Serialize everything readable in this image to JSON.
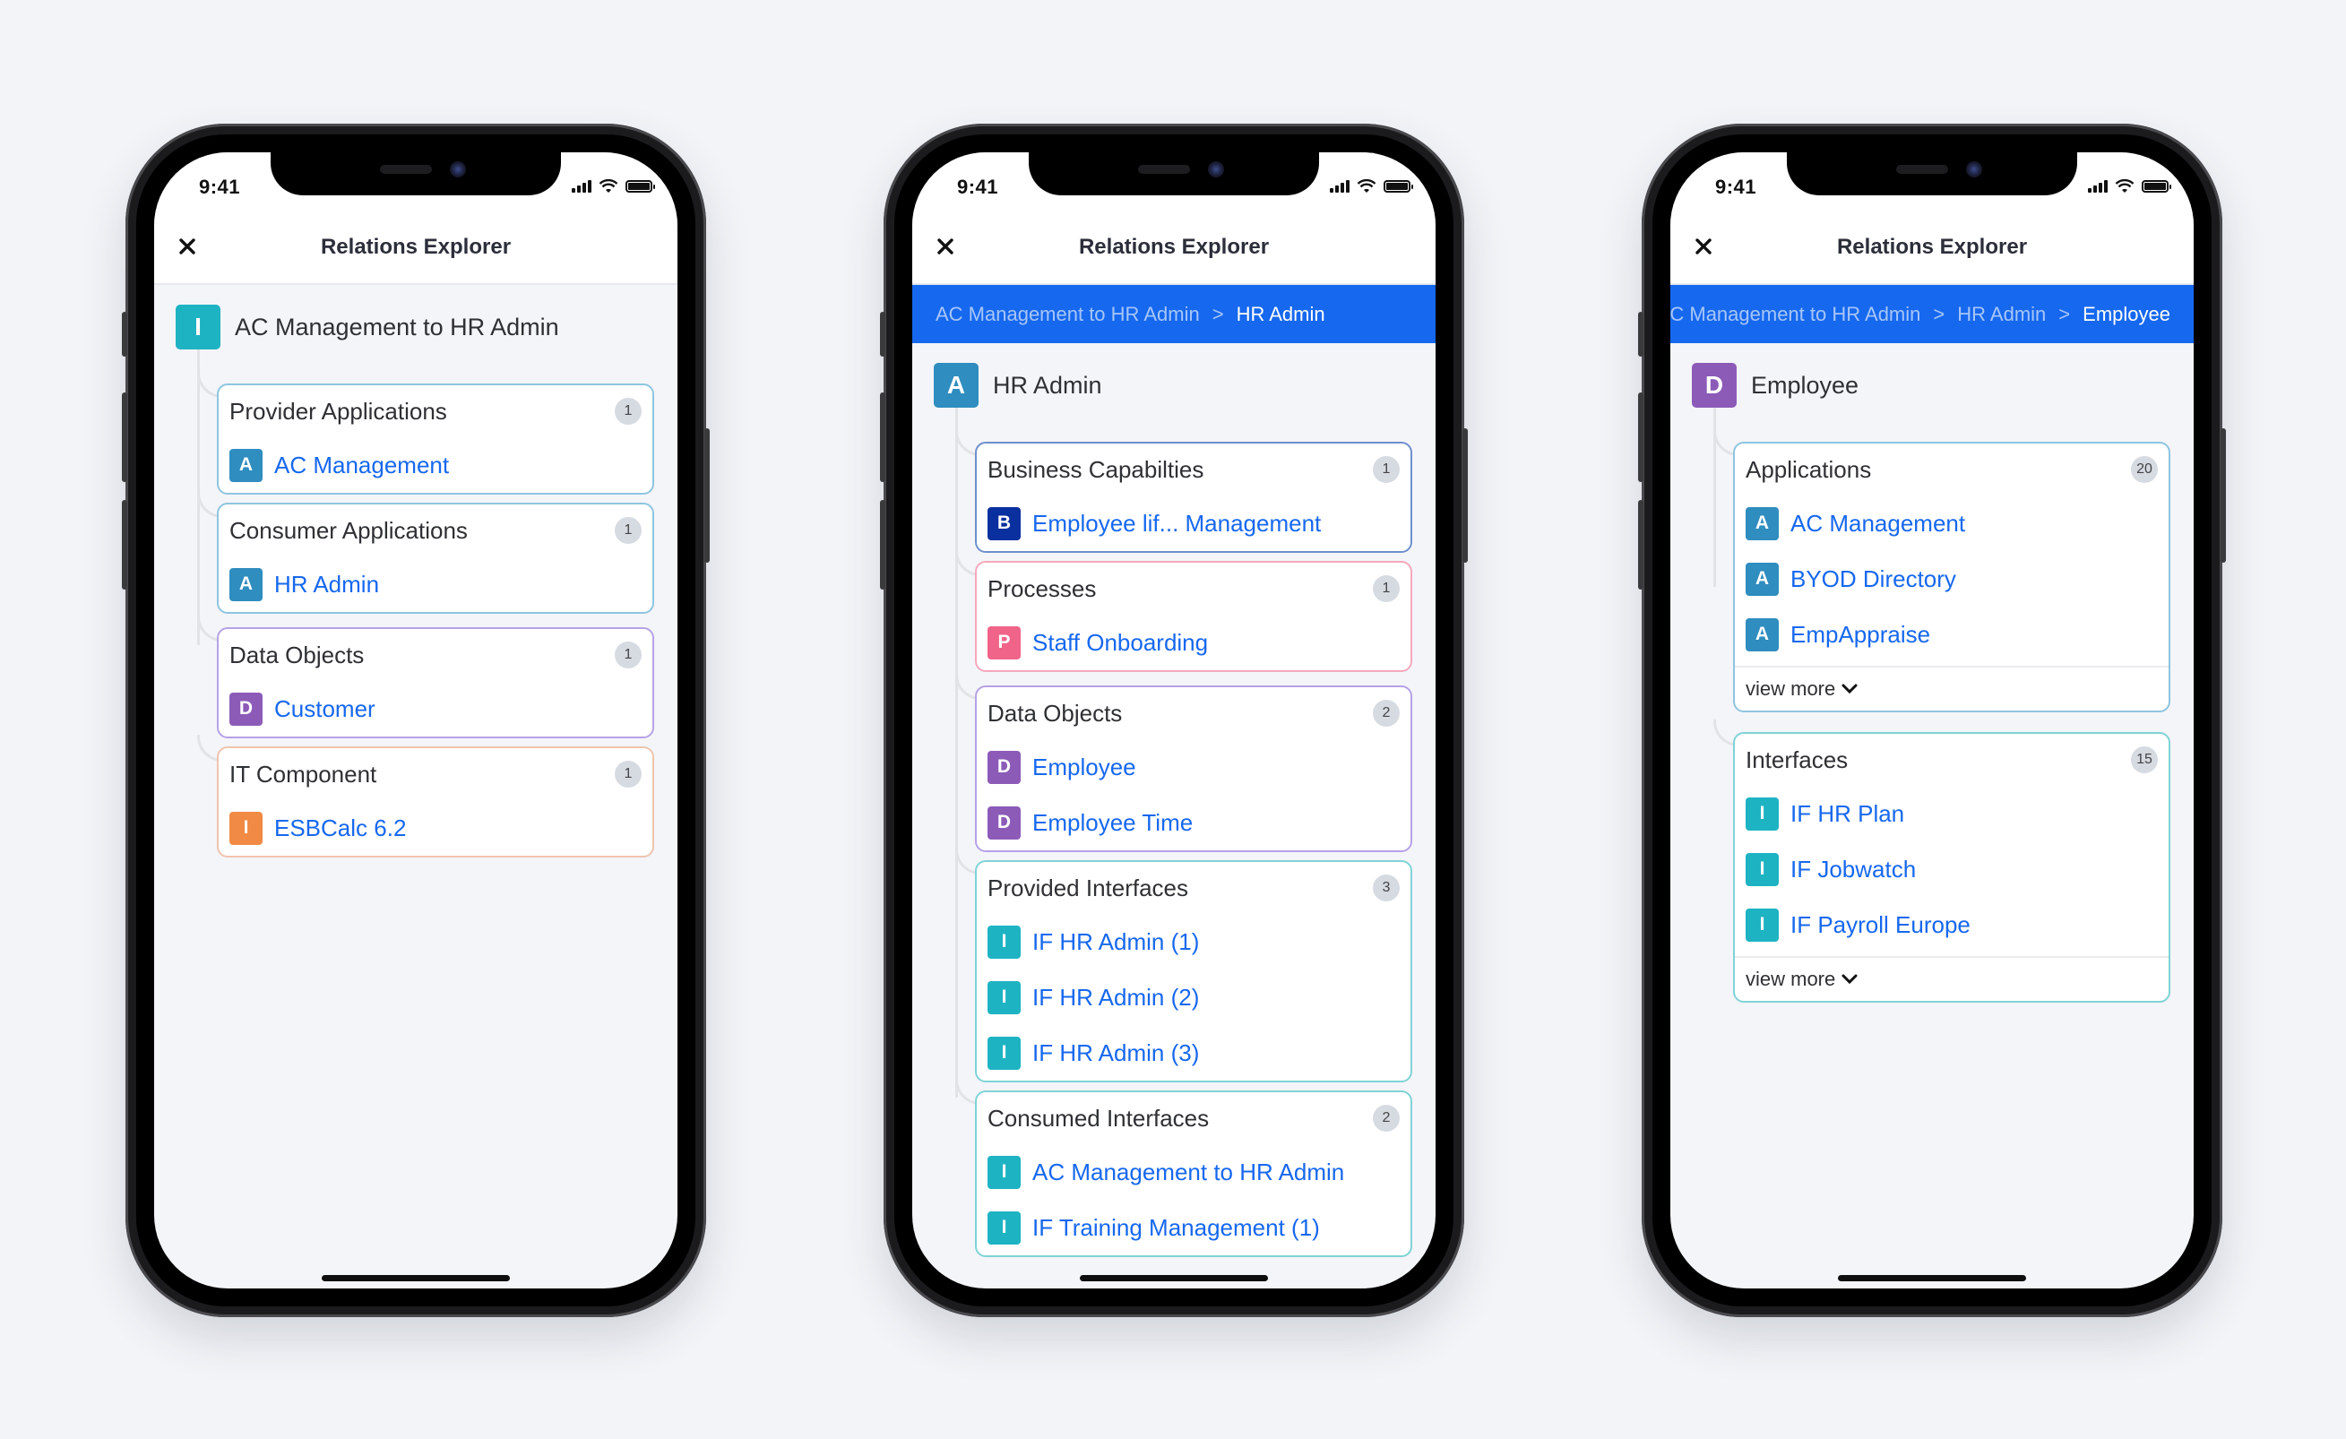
{
  "colors": {
    "accent": "#1668ee",
    "application": "#2f8dbf",
    "interface": "#1eb3c2",
    "data_object": "#8c5bb8",
    "it_component": "#f08a45",
    "business_capability": "#0a2f9e",
    "process": "#f06489"
  },
  "screens": [
    {
      "status_time": "9:41",
      "title": "Relations Explorer",
      "root": {
        "type_letter": "I",
        "label": "AC Management to HR Admin"
      },
      "sections": [
        {
          "title": "Provider Applications",
          "count": "1",
          "items": [
            {
              "letter": "A",
              "label": "AC Management"
            }
          ]
        },
        {
          "title": "Consumer Applications",
          "count": "1",
          "items": [
            {
              "letter": "A",
              "label": "HR Admin"
            }
          ]
        },
        {
          "title": "Data Objects",
          "count": "1",
          "items": [
            {
              "letter": "D",
              "label": "Customer"
            }
          ]
        },
        {
          "title": "IT Component",
          "count": "1",
          "items": [
            {
              "letter": "I",
              "label": "ESBCalc 6.2"
            }
          ]
        }
      ]
    },
    {
      "status_time": "9:41",
      "title": "Relations Explorer",
      "breadcrumb": [
        "AC Management to HR Admin",
        "HR Admin"
      ],
      "breadcrumb_separator": ">",
      "root": {
        "type_letter": "A",
        "label": "HR Admin"
      },
      "sections": [
        {
          "title": "Business Capabilties",
          "count": "1",
          "items": [
            {
              "letter": "B",
              "label": "Employee lif... Management"
            }
          ]
        },
        {
          "title": "Processes",
          "count": "1",
          "items": [
            {
              "letter": "P",
              "label": "Staff Onboarding"
            }
          ]
        },
        {
          "title": "Data Objects",
          "count": "2",
          "items": [
            {
              "letter": "D",
              "label": "Employee"
            },
            {
              "letter": "D",
              "label": "Employee Time"
            }
          ]
        },
        {
          "title": "Provided Interfaces",
          "count": "3",
          "items": [
            {
              "letter": "I",
              "label": "IF HR Admin (1)"
            },
            {
              "letter": "I",
              "label": "IF HR Admin (2)"
            },
            {
              "letter": "I",
              "label": "IF HR Admin (3)"
            }
          ]
        },
        {
          "title": "Consumed Interfaces",
          "count": "2",
          "items": [
            {
              "letter": "I",
              "label": "AC Management to HR Admin"
            },
            {
              "letter": "I",
              "label": "IF Training Management (1)"
            }
          ]
        }
      ]
    },
    {
      "status_time": "9:41",
      "title": "Relations Explorer",
      "breadcrumb": [
        "AC Management to HR Admin",
        "HR Admin",
        "Employee"
      ],
      "breadcrumb_separator": ">",
      "root": {
        "type_letter": "D",
        "label": "Employee"
      },
      "sections": [
        {
          "title": "Applications",
          "count": "20",
          "items": [
            {
              "letter": "A",
              "label": "AC Management"
            },
            {
              "letter": "A",
              "label": "BYOD Directory"
            },
            {
              "letter": "A",
              "label": "EmpAppraise"
            }
          ],
          "more_label": "view more"
        },
        {
          "title": "Interfaces",
          "count": "15",
          "items": [
            {
              "letter": "I",
              "label": "IF HR Plan"
            },
            {
              "letter": "I",
              "label": "IF Jobwatch"
            },
            {
              "letter": "I",
              "label": "IF Payroll Europe"
            }
          ],
          "more_label": "view more"
        }
      ]
    }
  ]
}
